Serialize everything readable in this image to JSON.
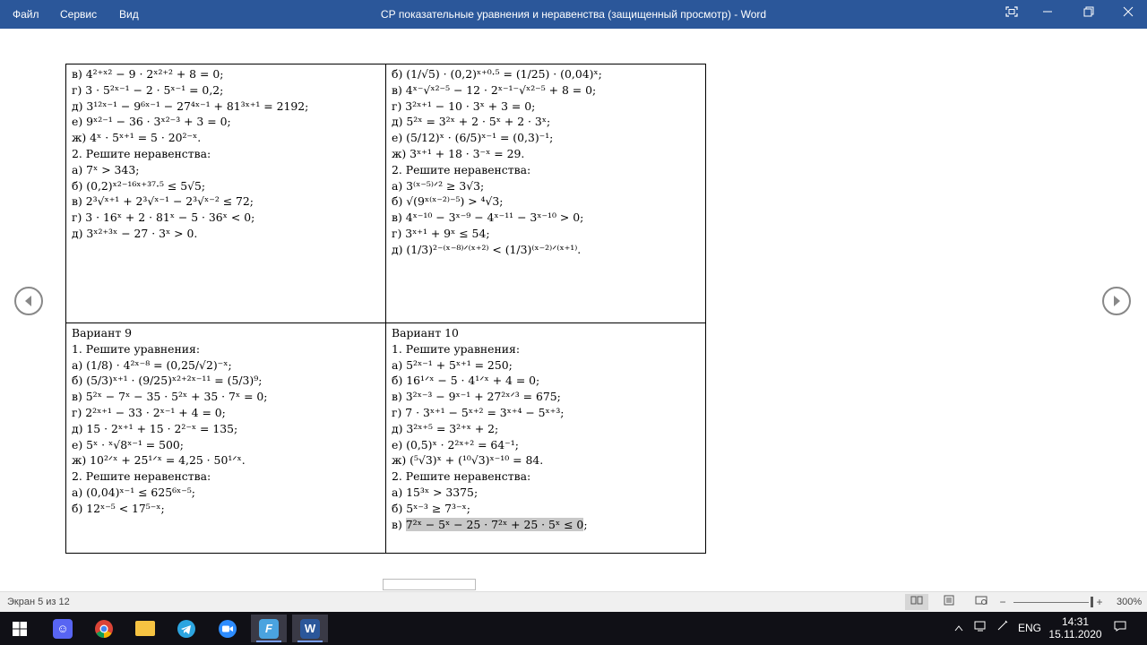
{
  "titlebar": {
    "menu": [
      "Файл",
      "Сервис",
      "Вид"
    ],
    "title": "СР показательные уравнения и неравенства (защищенный просмотр) - Word",
    "icons": [
      "fullscreen-icon",
      "minimize-icon",
      "restore-icon",
      "close-icon"
    ]
  },
  "document": {
    "cell_tl": [
      "в) 4²⁺ˣ² − 9 · 2ˣ²⁺² + 8 = 0;",
      "г) 3 · 5²ˣ⁻¹ − 2 · 5ˣ⁻¹ = 0,2;",
      "д) 3¹²ˣ⁻¹ − 9⁶ˣ⁻¹ − 27⁴ˣ⁻¹ + 81³ˣ⁺¹ = 2192;",
      "е) 9ˣ²⁻¹ − 36 · 3ˣ²⁻³ + 3 = 0;",
      "ж) 4ˣ · 5ˣ⁺¹ = 5 · 20²⁻ˣ.",
      "2. Решите неравенства:",
      "а) 7ˣ > 343;",
      "б) (0,2)ˣ²⁻¹⁶ˣ⁺³⁷·⁵ ≤ 5√5;",
      "в) 2³√ˣ⁺¹ + 2³√ˣ⁻¹ − 2³√ˣ⁻² ≤ 72;",
      "г) 3 · 16ˣ + 2 · 81ˣ − 5 · 36ˣ < 0;",
      "д) 3ˣ²⁺³ˣ − 27 · 3ˣ > 0."
    ],
    "cell_tr": [
      "б) (1/√5) · (0,2)ˣ⁺⁰·⁵ = (1/25) · (0,04)ˣ;",
      "в) 4ˣ⁻√ˣ²⁻⁵ − 12 · 2ˣ⁻¹⁻√ˣ²⁻⁵ + 8 = 0;",
      "г) 3²ˣ⁺¹ − 10 · 3ˣ + 3 = 0;",
      "д) 5²ˣ = 3²ˣ + 2 · 5ˣ + 2 · 3ˣ;",
      "е) (5/12)ˣ · (6/5)ˣ⁻¹ = (0,3)⁻¹;",
      "ж) 3ˣ⁺¹ + 18 · 3⁻ˣ = 29.",
      "2. Решите неравенства:",
      "а) 3⁽ˣ⁻⁵⁾ᐟ² ≥ 3√3;",
      "б) √(9ˣ⁽ˣ⁻²⁾⁻⁵) > ⁴√3;",
      "в) 4ˣ⁻¹⁰ − 3ˣ⁻⁹ − 4ˣ⁻¹¹ − 3ˣ⁻¹⁰ > 0;",
      "г) 3ˣ⁺¹ + 9ˣ ≤ 54;",
      "д) (1/3)²⁻⁽ˣ⁻⁸⁾ᐟ⁽ˣ⁺²⁾ < (1/3)⁽ˣ⁻²⁾ᐟ⁽ˣ⁺¹⁾."
    ],
    "cell_bl": [
      "Вариант 9",
      "1. Решите уравнения:",
      "а) (1/8) · 4²ˣ⁻⁸ = (0,25/√2)⁻ˣ;",
      "б) (5/3)ˣ⁺¹ · (9/25)ˣ²⁺²ˣ⁻¹¹ = (5/3)⁹;",
      "в) 5²ˣ − 7ˣ − 35 · 5²ˣ + 35 · 7ˣ = 0;",
      "г) 2²ˣ⁺¹ − 33 · 2ˣ⁻¹ + 4 = 0;",
      "д) 15 · 2ˣ⁺¹ + 15 · 2²⁻ˣ = 135;",
      "е) 5ˣ · ˣ√8ˣ⁻¹ = 500;",
      "ж) 10²ᐟˣ + 25¹ᐟˣ = 4,25 · 50¹ᐟˣ.",
      "2. Решите неравенства:",
      "а) (0,04)ˣ⁻¹ ≤ 625⁶ˣ⁻⁵;",
      "б) 12ˣ⁻⁵ < 17⁵⁻ˣ;"
    ],
    "cell_br": [
      "Вариант 10",
      "1. Решите уравнения:",
      "а) 5²ˣ⁻¹ + 5ˣ⁺¹ = 250;",
      "б) 16¹ᐟˣ − 5 · 4¹ᐟˣ + 4 = 0;",
      "в) 3²ˣ⁻³ − 9ˣ⁻¹ + 27²ˣᐟ³ = 675;",
      "г) 7 · 3ˣ⁺¹ − 5ˣ⁺² = 3ˣ⁺⁴ − 5ˣ⁺³;",
      "д) 3²ˣ⁺⁵ = 3²⁺ˣ + 2;",
      "е) (0,5)ˣ · 2²ˣ⁺² = 64⁻¹;",
      "ж) (⁵√3)ˣ + (¹⁰√3)ˣ⁻¹⁰ = 84.",
      "2. Решите неравенства:",
      "а) 15³ˣ > 3375;",
      "б) 5ˣ⁻³ ≥ 7³⁻ˣ;"
    ],
    "cell_br_last": {
      "prefix": "в) ",
      "highlighted": "7²ˣ − 5ˣ − 25 · 7²ˣ + 25 · 5ˣ ≤ 0",
      "suffix": ";"
    }
  },
  "nav": {
    "prev_icon": "prev-page-icon",
    "next_icon": "next-page-icon"
  },
  "statusbar": {
    "page_info": "Экран 5 из 12",
    "zoom_percent": "300%",
    "zoom_level": 300,
    "view_icons": [
      "read-mode-icon",
      "print-layout-icon",
      "web-layout-icon"
    ]
  },
  "taskbar": {
    "apps": [
      "windows-start-icon",
      "discord-icon",
      "chrome-icon",
      "file-explorer-icon",
      "telegram-icon",
      "zoom-icon",
      "fl-app-icon",
      "word-icon"
    ],
    "language": "ENG",
    "time": "14:31",
    "date": "15.11.2020"
  }
}
